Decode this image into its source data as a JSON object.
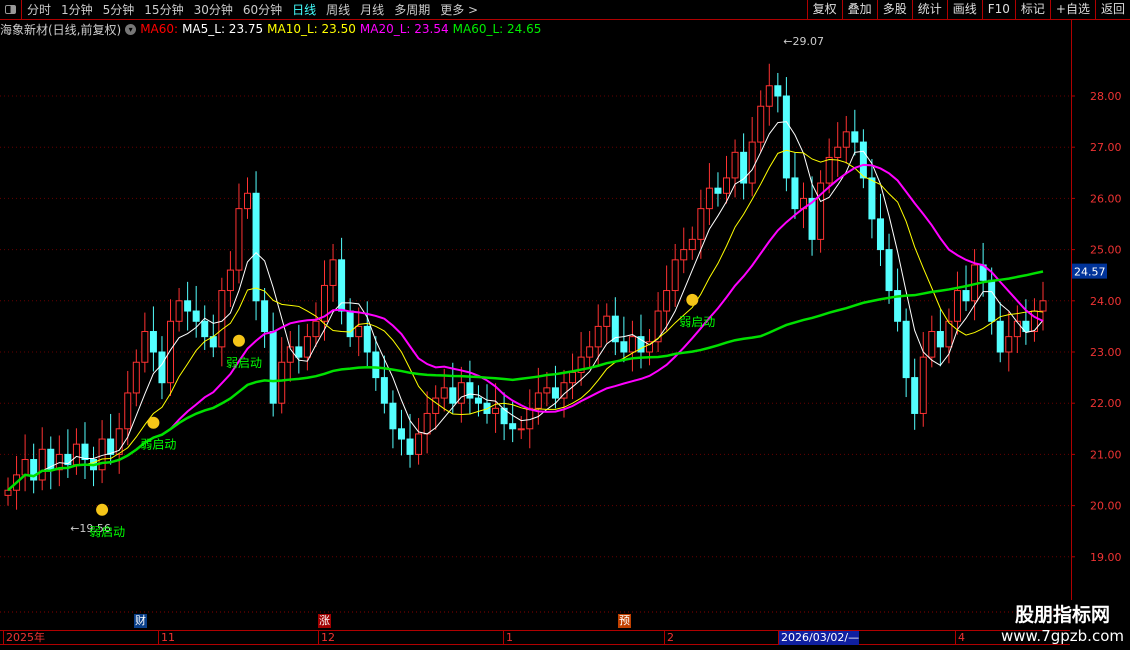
{
  "toolbar": {
    "periods": [
      "分时",
      "1分钟",
      "5分钟",
      "15分钟",
      "30分钟",
      "60分钟",
      "日线",
      "周线",
      "月线",
      "多周期",
      "更多 >"
    ],
    "active": "日线",
    "right_buttons": [
      "复权",
      "叠加",
      "多股",
      "统计",
      "画线",
      "F10",
      "标记",
      "+自选",
      "返回"
    ]
  },
  "info": {
    "name": "海象新材(日线,前复权)",
    "ma60_tag": "MA60:",
    "ma5": "MA5_L: 23.75",
    "ma10": "MA10_L: 23.50",
    "ma20": "MA20_L: 23.54",
    "ma60": "MA60_L: 24.65"
  },
  "colors": {
    "up": "#ff3232",
    "down": "#54ffff",
    "ma5": "#ffffff",
    "ma10": "#ffff00",
    "ma20": "#ff00ff",
    "ma60": "#00e000"
  },
  "chart_data": {
    "type": "candlestick",
    "ylim": [
      18.5,
      29.5
    ],
    "yticks": [
      "28.00",
      "27.00",
      "26.00",
      "25.00",
      "24.00",
      "23.00",
      "22.00",
      "21.00",
      "20.00",
      "19.00"
    ],
    "current_price": "24.57",
    "high_label": "29.07",
    "low_label": "19.56",
    "close": [
      20.3,
      20.6,
      20.9,
      20.5,
      21.1,
      20.7,
      21.0,
      20.8,
      21.2,
      20.9,
      20.7,
      21.3,
      21.0,
      21.5,
      22.2,
      22.8,
      23.4,
      23.0,
      22.4,
      23.6,
      24.0,
      23.8,
      23.6,
      23.3,
      23.1,
      24.2,
      24.6,
      25.8,
      26.1,
      24.0,
      23.4,
      22.0,
      22.8,
      23.1,
      22.9,
      23.3,
      23.6,
      24.3,
      24.8,
      23.8,
      23.3,
      23.5,
      23.0,
      22.5,
      22.0,
      21.5,
      21.3,
      21.0,
      21.4,
      21.8,
      22.1,
      22.3,
      22.0,
      22.4,
      22.1,
      22.0,
      21.8,
      21.9,
      21.6,
      21.5,
      21.5,
      21.9,
      22.2,
      22.3,
      22.1,
      22.4,
      22.6,
      22.9,
      23.1,
      23.5,
      23.7,
      23.2,
      23.0,
      23.3,
      23.0,
      23.2,
      23.8,
      24.2,
      24.8,
      25.0,
      25.2,
      25.8,
      26.2,
      26.1,
      26.4,
      26.9,
      26.3,
      27.1,
      27.8,
      28.2,
      28.0,
      26.4,
      25.8,
      26.0,
      25.2,
      26.3,
      26.8,
      27.0,
      27.3,
      27.1,
      26.4,
      25.6,
      25.0,
      24.2,
      23.6,
      22.5,
      21.8,
      22.9,
      23.4,
      23.1,
      23.6,
      24.2,
      24.0,
      24.7,
      24.4,
      23.6,
      23.0,
      23.3,
      23.6,
      23.4,
      23.8,
      24.0
    ],
    "signals": [
      {
        "index": 11,
        "text": "弱启动"
      },
      {
        "index": 17,
        "text": "弱启动"
      },
      {
        "index": 27,
        "text": "弱启动"
      },
      {
        "index": 80,
        "text": "弱启动"
      }
    ],
    "time_ticks": [
      "2025年",
      "11",
      "12",
      "1",
      "2",
      "2026/03/02/—",
      "4"
    ],
    "events": [
      "财",
      "涨",
      "预"
    ]
  },
  "logo": {
    "line1": "股朋指标网",
    "line2": "www.7gpzb.com"
  }
}
